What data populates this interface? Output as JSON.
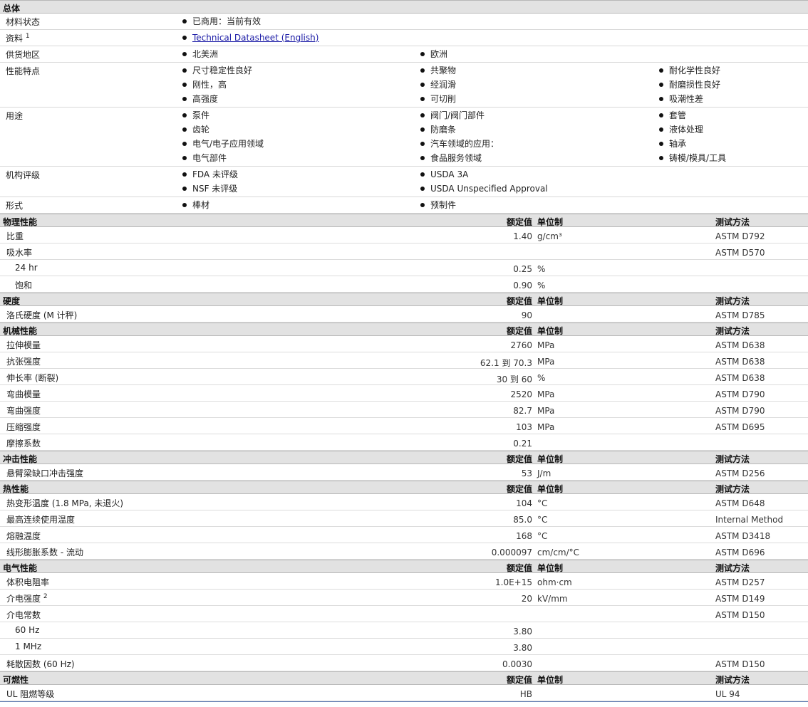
{
  "general": {
    "title": "总体",
    "rows": [
      {
        "label": "材料状态",
        "sup": "",
        "cols": [
          [
            {
              "text": "已商用：当前有效",
              "link": false
            }
          ]
        ]
      },
      {
        "label": "资料",
        "sup": "1",
        "cols": [
          [
            {
              "text": "Technical Datasheet (English)",
              "link": true
            }
          ]
        ]
      },
      {
        "label": "供货地区",
        "sup": "",
        "cols": [
          [
            {
              "text": "北美洲",
              "link": false
            }
          ],
          [
            {
              "text": "欧洲",
              "link": false
            }
          ]
        ]
      },
      {
        "label": "性能特点",
        "sup": "",
        "cols": [
          [
            {
              "text": "尺寸稳定性良好",
              "link": false
            },
            {
              "text": "刚性，高",
              "link": false
            },
            {
              "text": "高强度",
              "link": false
            }
          ],
          [
            {
              "text": "共聚物",
              "link": false
            },
            {
              "text": "经润滑",
              "link": false
            },
            {
              "text": "可切削",
              "link": false
            }
          ],
          [
            {
              "text": "耐化学性良好",
              "link": false
            },
            {
              "text": "耐磨损性良好",
              "link": false
            },
            {
              "text": "吸潮性差",
              "link": false
            }
          ]
        ]
      },
      {
        "label": "用途",
        "sup": "",
        "cols": [
          [
            {
              "text": "泵件",
              "link": false
            },
            {
              "text": "齿轮",
              "link": false
            },
            {
              "text": "电气/电子应用领域",
              "link": false
            },
            {
              "text": "电气部件",
              "link": false
            }
          ],
          [
            {
              "text": "阀门/阀门部件",
              "link": false
            },
            {
              "text": "防磨条",
              "link": false
            },
            {
              "text": "汽车领域的应用：",
              "link": false
            },
            {
              "text": "食品服务领域",
              "link": false
            }
          ],
          [
            {
              "text": "套管",
              "link": false
            },
            {
              "text": "液体处理",
              "link": false
            },
            {
              "text": "轴承",
              "link": false
            },
            {
              "text": "铸模/模具/工具",
              "link": false
            }
          ]
        ]
      },
      {
        "label": "机构评级",
        "sup": "",
        "cols": [
          [
            {
              "text": "FDA 未评级",
              "link": false
            },
            {
              "text": "NSF 未评级",
              "link": false
            }
          ],
          [
            {
              "text": "USDA 3A",
              "link": false
            },
            {
              "text": "USDA Unspecified Approval",
              "link": false
            }
          ]
        ]
      },
      {
        "label": "形式",
        "sup": "",
        "cols": [
          [
            {
              "text": "棒材",
              "link": false
            }
          ],
          [
            {
              "text": "预制件",
              "link": false
            }
          ]
        ]
      }
    ]
  },
  "headers": {
    "value": "额定值",
    "unit": "单位制",
    "method": "测试方法"
  },
  "sections": [
    {
      "title": "物理性能",
      "rows": [
        {
          "name": "比重",
          "value": "1.40",
          "unit": "g/cm³",
          "method": "ASTM D792"
        },
        {
          "name": "吸水率",
          "value": "",
          "unit": "",
          "method": "ASTM D570"
        },
        {
          "name": "24 hr",
          "sub": true,
          "value": "0.25",
          "unit": "%",
          "method": ""
        },
        {
          "name": "饱和",
          "sub": true,
          "value": "0.90",
          "unit": "%",
          "method": ""
        }
      ]
    },
    {
      "title": "硬度",
      "rows": [
        {
          "name": "洛氏硬度 (M 计秤)",
          "value": "90",
          "unit": "",
          "method": "ASTM D785"
        }
      ]
    },
    {
      "title": "机械性能",
      "rows": [
        {
          "name": "拉伸模量",
          "value": "2760",
          "unit": "MPa",
          "method": "ASTM D638"
        },
        {
          "name": "抗张强度",
          "value": "62.1 到 70.3",
          "unit": "MPa",
          "method": "ASTM D638"
        },
        {
          "name": "伸长率 (断裂)",
          "value": "30 到 60",
          "unit": "%",
          "method": "ASTM D638"
        },
        {
          "name": "弯曲模量",
          "value": "2520",
          "unit": "MPa",
          "method": "ASTM D790"
        },
        {
          "name": "弯曲强度",
          "value": "82.7",
          "unit": "MPa",
          "method": "ASTM D790"
        },
        {
          "name": "压缩强度",
          "value": "103",
          "unit": "MPa",
          "method": "ASTM D695"
        },
        {
          "name": "摩擦系数",
          "value": "0.21",
          "unit": "",
          "method": ""
        }
      ]
    },
    {
      "title": "冲击性能",
      "rows": [
        {
          "name": "悬臂梁缺口冲击强度",
          "value": "53",
          "unit": "J/m",
          "method": "ASTM D256"
        }
      ]
    },
    {
      "title": "热性能",
      "rows": [
        {
          "name": "热变形温度 (1.8 MPa, 未退火)",
          "value": "104",
          "unit": "°C",
          "method": "ASTM D648"
        },
        {
          "name": "最高连续使用温度",
          "value": "85.0",
          "unit": "°C",
          "method": "Internal Method"
        },
        {
          "name": "熔融温度",
          "value": "168",
          "unit": "°C",
          "method": "ASTM D3418"
        },
        {
          "name": "线形膨胀系数 - 流动",
          "value": "0.000097",
          "unit": "cm/cm/°C",
          "method": "ASTM D696"
        }
      ]
    },
    {
      "title": "电气性能",
      "rows": [
        {
          "name": "体积电阻率",
          "value": "1.0E+15",
          "unit": "ohm·cm",
          "method": "ASTM D257"
        },
        {
          "name": "介电强度",
          "sup": "2",
          "value": "20",
          "unit": "kV/mm",
          "method": "ASTM D149"
        },
        {
          "name": "介电常数",
          "value": "",
          "unit": "",
          "method": "ASTM D150"
        },
        {
          "name": "60 Hz",
          "sub": true,
          "value": "3.80",
          "unit": "",
          "method": ""
        },
        {
          "name": "1 MHz",
          "sub": true,
          "value": "3.80",
          "unit": "",
          "method": ""
        },
        {
          "name": "耗散因数 (60 Hz)",
          "value": "0.0030",
          "unit": "",
          "method": "ASTM D150"
        }
      ]
    },
    {
      "title": "可燃性",
      "rows": [
        {
          "name": "UL 阻燃等级",
          "value": "HB",
          "unit": "",
          "method": "UL 94"
        }
      ]
    }
  ]
}
